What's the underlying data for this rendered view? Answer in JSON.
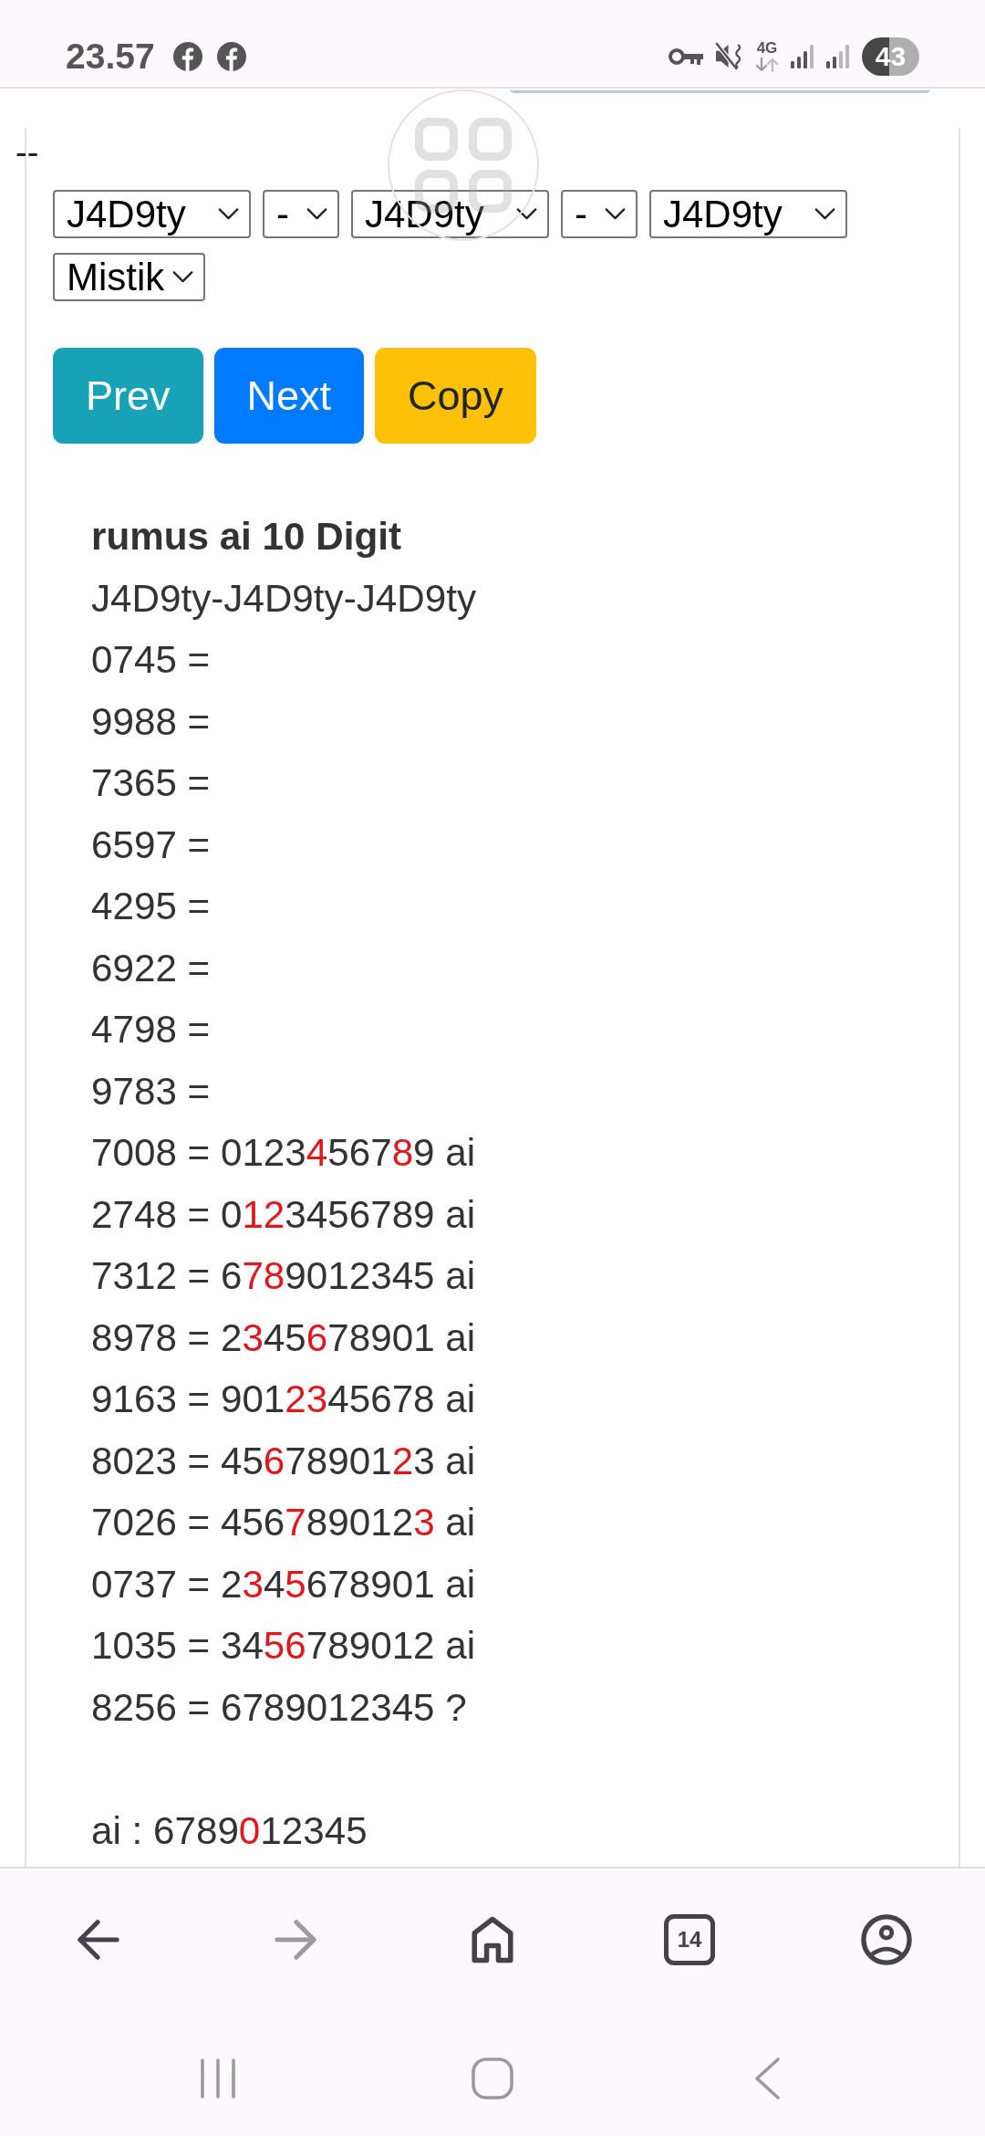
{
  "status_bar": {
    "time": "23.57",
    "network": "4G",
    "battery": "43"
  },
  "page": {
    "prefix": "--",
    "dropdowns": [
      {
        "value": "J4D9ty"
      },
      {
        "value": "-"
      },
      {
        "value": "J4D9ty"
      },
      {
        "value": "-"
      },
      {
        "value": "J4D9ty"
      },
      {
        "value": "Mistik"
      }
    ],
    "buttons": [
      {
        "label": "Prev",
        "kind": "info"
      },
      {
        "label": "Next",
        "kind": "primary"
      },
      {
        "label": "Copy",
        "kind": "warning"
      }
    ]
  },
  "result": {
    "title": "rumus ai 10 Digit",
    "pattern": "J4D9ty-J4D9ty-J4D9ty",
    "rows": [
      {
        "segments": [
          {
            "text": "0745 =",
            "highlighted": false
          }
        ]
      },
      {
        "segments": [
          {
            "text": "9988 =",
            "highlighted": false
          }
        ]
      },
      {
        "segments": [
          {
            "text": "7365 =",
            "highlighted": false
          }
        ]
      },
      {
        "segments": [
          {
            "text": "6597 =",
            "highlighted": false
          }
        ]
      },
      {
        "segments": [
          {
            "text": "4295 =",
            "highlighted": false
          }
        ]
      },
      {
        "segments": [
          {
            "text": "6922 =",
            "highlighted": false
          }
        ]
      },
      {
        "segments": [
          {
            "text": "4798 =",
            "highlighted": false
          }
        ]
      },
      {
        "segments": [
          {
            "text": "9783 =",
            "highlighted": false
          }
        ]
      },
      {
        "segments": [
          {
            "text": "7008 = 0123",
            "highlighted": false
          },
          {
            "text": "4",
            "highlighted": true
          },
          {
            "text": "567",
            "highlighted": false
          },
          {
            "text": "8",
            "highlighted": true
          },
          {
            "text": "9 ai",
            "highlighted": false
          }
        ]
      },
      {
        "segments": [
          {
            "text": "2748 = 0",
            "highlighted": false
          },
          {
            "text": "12",
            "highlighted": true
          },
          {
            "text": "3456789 ai",
            "highlighted": false
          }
        ]
      },
      {
        "segments": [
          {
            "text": "7312 = 6",
            "highlighted": false
          },
          {
            "text": "78",
            "highlighted": true
          },
          {
            "text": "9012345 ai",
            "highlighted": false
          }
        ]
      },
      {
        "segments": [
          {
            "text": "8978 = 2",
            "highlighted": false
          },
          {
            "text": "3",
            "highlighted": true
          },
          {
            "text": "45",
            "highlighted": false
          },
          {
            "text": "6",
            "highlighted": true
          },
          {
            "text": "78901 ai",
            "highlighted": false
          }
        ]
      },
      {
        "segments": [
          {
            "text": "9163 = 901",
            "highlighted": false
          },
          {
            "text": "23",
            "highlighted": true
          },
          {
            "text": "45678 ai",
            "highlighted": false
          }
        ]
      },
      {
        "segments": [
          {
            "text": "8023 = 45",
            "highlighted": false
          },
          {
            "text": "6",
            "highlighted": true
          },
          {
            "text": "78901",
            "highlighted": false
          },
          {
            "text": "2",
            "highlighted": true
          },
          {
            "text": "3 ai",
            "highlighted": false
          }
        ]
      },
      {
        "segments": [
          {
            "text": "7026 = 456",
            "highlighted": false
          },
          {
            "text": "7",
            "highlighted": true
          },
          {
            "text": "89012",
            "highlighted": false
          },
          {
            "text": "3",
            "highlighted": true
          },
          {
            "text": " ai",
            "highlighted": false
          }
        ]
      },
      {
        "segments": [
          {
            "text": "0737 = 2",
            "highlighted": false
          },
          {
            "text": "3",
            "highlighted": true
          },
          {
            "text": "4",
            "highlighted": false
          },
          {
            "text": "5",
            "highlighted": true
          },
          {
            "text": "678901 ai",
            "highlighted": false
          }
        ]
      },
      {
        "segments": [
          {
            "text": "1035 = 34",
            "highlighted": false
          },
          {
            "text": "56",
            "highlighted": true
          },
          {
            "text": "789012 ai",
            "highlighted": false
          }
        ]
      },
      {
        "segments": [
          {
            "text": "8256 = 6789012345 ?",
            "highlighted": false
          }
        ]
      }
    ],
    "summary": {
      "segments": [
        {
          "text": "ai : 6789",
          "highlighted": false
        },
        {
          "text": "0",
          "highlighted": true
        },
        {
          "text": "12345",
          "highlighted": false
        }
      ]
    }
  },
  "browser_toolbar": {
    "back": {
      "disabled": false
    },
    "forward": {
      "disabled": true
    },
    "tab_count": "14"
  }
}
